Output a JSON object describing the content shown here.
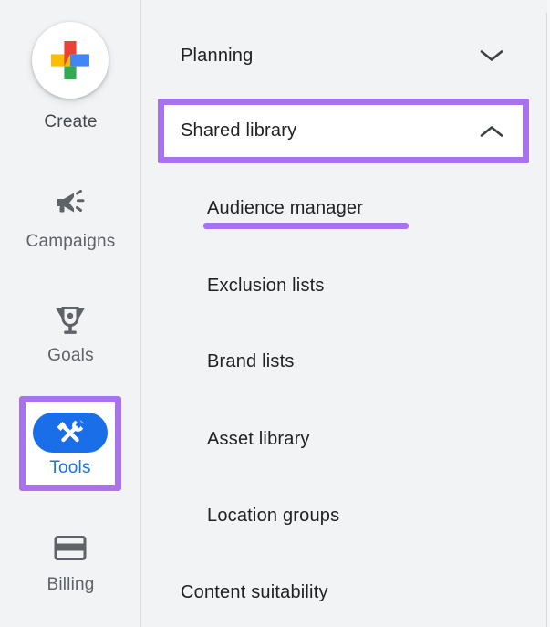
{
  "colors": {
    "background": "#f1f3f4",
    "divider": "#dadce0",
    "annotation_purple": "#a873ea",
    "tools_pill_blue": "#1a6ee8",
    "tools_label_blue": "#1a73e8",
    "rail_label_gray": "#5f6368",
    "menu_text": "#202124",
    "plus_red": "#ea4335",
    "plus_yellow": "#fbbc04",
    "plus_blue": "#4285f4",
    "plus_green": "#34a853"
  },
  "left_rail": {
    "items": [
      {
        "label": "Create",
        "icon": "google-plus-icon",
        "selected": false,
        "annotated": false
      },
      {
        "label": "Campaigns",
        "icon": "megaphone-icon",
        "selected": false,
        "annotated": false
      },
      {
        "label": "Goals",
        "icon": "trophy-icon",
        "selected": false,
        "annotated": false
      },
      {
        "label": "Tools",
        "icon": "hammer-wrench-icon",
        "selected": true,
        "annotated": true
      },
      {
        "label": "Billing",
        "icon": "credit-card-icon",
        "selected": false,
        "annotated": false
      }
    ]
  },
  "menu": {
    "items": [
      {
        "label": "Planning",
        "level": "top",
        "chevron": "down",
        "annotated": false,
        "underlined": false
      },
      {
        "label": "Shared library",
        "level": "top",
        "chevron": "up",
        "annotated": true,
        "underlined": false
      },
      {
        "label": "Audience manager",
        "level": "sub",
        "chevron": "none",
        "annotated": false,
        "underlined": true
      },
      {
        "label": "Exclusion lists",
        "level": "sub",
        "chevron": "none",
        "annotated": false,
        "underlined": false
      },
      {
        "label": "Brand lists",
        "level": "sub",
        "chevron": "none",
        "annotated": false,
        "underlined": false
      },
      {
        "label": "Asset library",
        "level": "sub",
        "chevron": "none",
        "annotated": false,
        "underlined": false
      },
      {
        "label": "Location groups",
        "level": "sub",
        "chevron": "none",
        "annotated": false,
        "underlined": false
      },
      {
        "label": "Content suitability",
        "level": "top",
        "chevron": "none",
        "annotated": false,
        "underlined": false
      }
    ]
  }
}
